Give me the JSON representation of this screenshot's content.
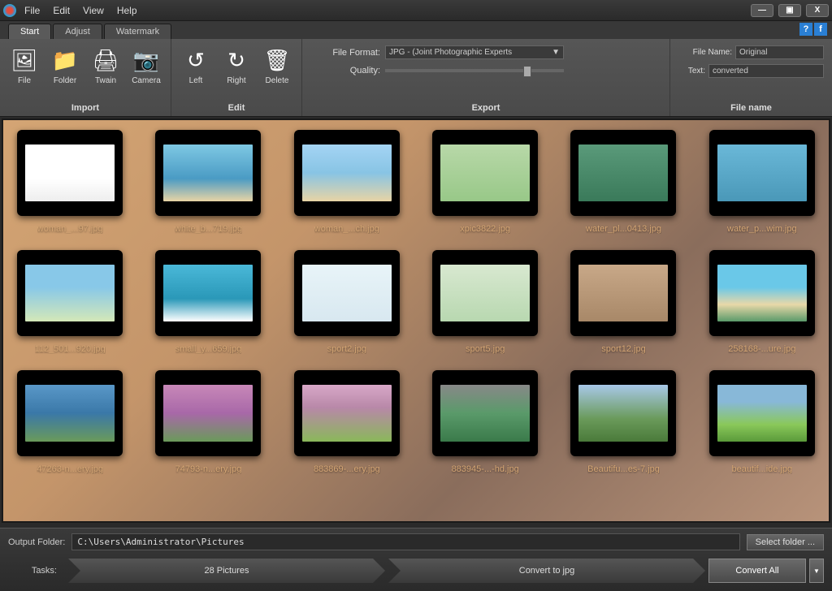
{
  "menu": {
    "file": "File",
    "edit": "Edit",
    "view": "View",
    "help": "Help"
  },
  "tabs": {
    "start": "Start",
    "adjust": "Adjust",
    "watermark": "Watermark"
  },
  "ribbon": {
    "import": {
      "label": "Import",
      "file": "File",
      "folder": "Folder",
      "twain": "Twain",
      "camera": "Camera"
    },
    "edit": {
      "label": "Edit",
      "left": "Left",
      "right": "Right",
      "delete": "Delete"
    },
    "export": {
      "label": "Export",
      "format_label": "File Format:",
      "format_value": "JPG - (Joint Photographic Experts",
      "quality_label": "Quality:"
    },
    "filename": {
      "label": "File name",
      "name_label": "File Name:",
      "name_value": "Original",
      "text_label": "Text:",
      "text_value": "converted"
    }
  },
  "thumbnails": [
    {
      "label": "woman_...97.jpg"
    },
    {
      "label": "white_b...719.jpg"
    },
    {
      "label": "woman_...ch.jpg"
    },
    {
      "label": "xpic3822.jpg"
    },
    {
      "label": "water_pl...0413.jpg"
    },
    {
      "label": "water_p...wim.jpg"
    },
    {
      "label": "112_501...920.jpg"
    },
    {
      "label": "small_y...659.jpg"
    },
    {
      "label": "sport2.jpg"
    },
    {
      "label": "sport5.jpg"
    },
    {
      "label": "sport12.jpg"
    },
    {
      "label": "258168-...ure.jpg"
    },
    {
      "label": "47263-n...ery.jpg"
    },
    {
      "label": "74793-n...ery.jpg"
    },
    {
      "label": "883869-...ery.jpg"
    },
    {
      "label": "883945-...-hd.jpg"
    },
    {
      "label": "Beautifu...es-7.jpg"
    },
    {
      "label": "beautif...ide.jpg"
    }
  ],
  "footer": {
    "output_label": "Output Folder:",
    "output_path": "C:\\Users\\Administrator\\Pictures",
    "select_folder": "Select folder ...",
    "tasks_label": "Tasks:",
    "task1": "28 Pictures",
    "task2": "Convert to jpg",
    "convert_all": "Convert All"
  }
}
